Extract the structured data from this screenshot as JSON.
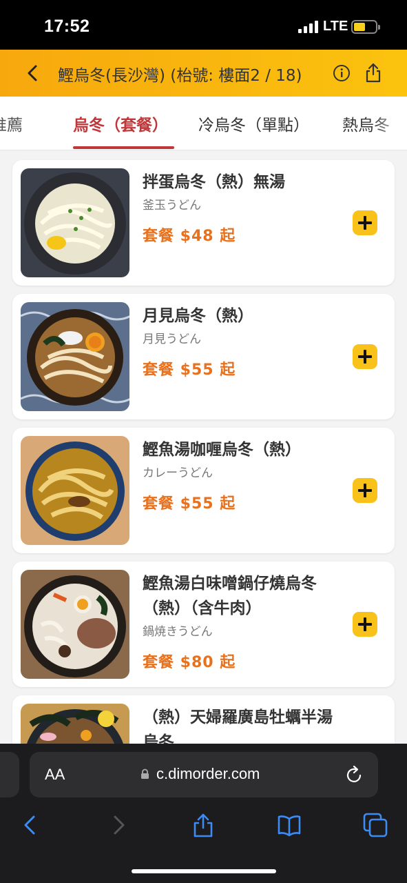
{
  "status_bar": {
    "time": "17:52",
    "network": "LTE"
  },
  "header": {
    "title": "鰹烏冬(長沙灣) (枱號: 樓面2 / 18)"
  },
  "tabs": [
    {
      "label": "推薦"
    },
    {
      "label": "烏冬（套餐）"
    },
    {
      "label": "冷烏冬（單點）"
    },
    {
      "label": "熱烏冬"
    }
  ],
  "menu_items": [
    {
      "name": "拌蛋烏冬（熱）無湯",
      "jp_name": "釜玉うどん",
      "price": "套餐 $48 起"
    },
    {
      "name": "月見烏冬（熱）",
      "jp_name": "月見うどん",
      "price": "套餐 $55 起"
    },
    {
      "name": "鰹魚湯咖喱烏冬（熱）",
      "jp_name": "カレーうどん",
      "price": "套餐 $55 起"
    },
    {
      "name": "鰹魚湯白味噌鍋仔燒烏冬（熱）（含牛肉）",
      "jp_name": "鍋焼きうどん",
      "price": "套餐 $80 起"
    },
    {
      "name": "（熱）天婦羅廣島牡蠣半湯烏冬"
    }
  ],
  "browser": {
    "aa_label": "AA",
    "url": "c.dimorder.com"
  },
  "colors": {
    "accent": "#c0373a",
    "price": "#e8711e",
    "header": "#f7a80d",
    "add_button": "#f8c21a"
  }
}
